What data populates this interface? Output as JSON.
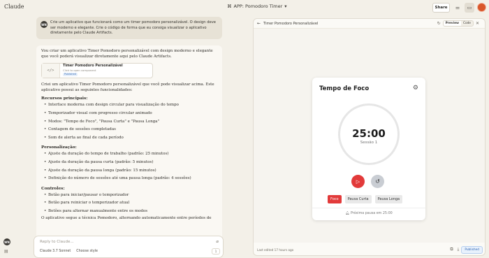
{
  "app": {
    "brand": "Claude",
    "doc_title": "APP: Pomodoro Timer",
    "share_label": "Share"
  },
  "user": {
    "initials": "WN",
    "message": "Crie um aplicativo que funcionará como um timer pomodoro personalizável. O design deve ser moderno e elegante. Crie o código de forma que eu consiga visualizar o aplicativo diretamente pelo Claude Artifacts."
  },
  "assistant": {
    "intro": "Vou criar um aplicativo Timer Pomodoro personalizável com design moderno e elegante que você poderá visualizar diretamente aqui pelo Claude Artifacts.",
    "artifact": {
      "title": "Timer Pomodoro Personalizável",
      "subtitle": "Click to open component",
      "badge": "Published"
    },
    "after_artifact": "Criei um aplicativo Timer Pomodoro personalizável que você pode visualizar acima. Este aplicativo possui as seguintes funcionalidades:",
    "section1_title": "Recursos principais:",
    "section1_items": [
      "Interface moderna com design circular para visualização do tempo",
      "Temporizador visual com progresso circular animado",
      "Modos: \"Tempo de Foco\", \"Pausa Curta\" e \"Pausa Longa\"",
      "Contagem de sessões completadas",
      "Som de alerta ao final de cada período"
    ],
    "section2_title": "Personalização:",
    "section2_items": [
      "Ajuste da duração do tempo de trabalho (padrão: 25 minutos)",
      "Ajuste da duração da pausa curta (padrão: 5 minutos)",
      "Ajuste da duração da pausa longa (padrão: 15 minutos)",
      "Definição do número de sessões até uma pausa longa (padrão: 4 sessões)"
    ],
    "section3_title": "Controles:",
    "section3_items": [
      "Botão para iniciar/pausar o temporizador",
      "Botão para reiniciar o temporizador atual",
      "Botões para alternar manualmente entre os modos"
    ],
    "outro": "O aplicativo segue a técnica Pomodoro, alternando automaticamente entre períodos de"
  },
  "composer": {
    "placeholder": "Reply to Claude...",
    "model": "Claude 3.7 Sonnet",
    "style": "Choose style",
    "count": "1"
  },
  "artifact_panel": {
    "title": "Timer Pomodoro Personalizável",
    "toggle_preview": "Preview",
    "toggle_code": "Code",
    "edited": "Last edited 17 hours ago",
    "published": "Published"
  },
  "pomodoro": {
    "heading": "Tempo de Foco",
    "time": "25:00",
    "session": "Sessão 1",
    "modes": [
      "Foco",
      "Pausa Curta",
      "Pausa Longa"
    ],
    "active_mode": "Foco",
    "next": "Próxima pausa em 25:00",
    "accent": "#e23a3a"
  }
}
